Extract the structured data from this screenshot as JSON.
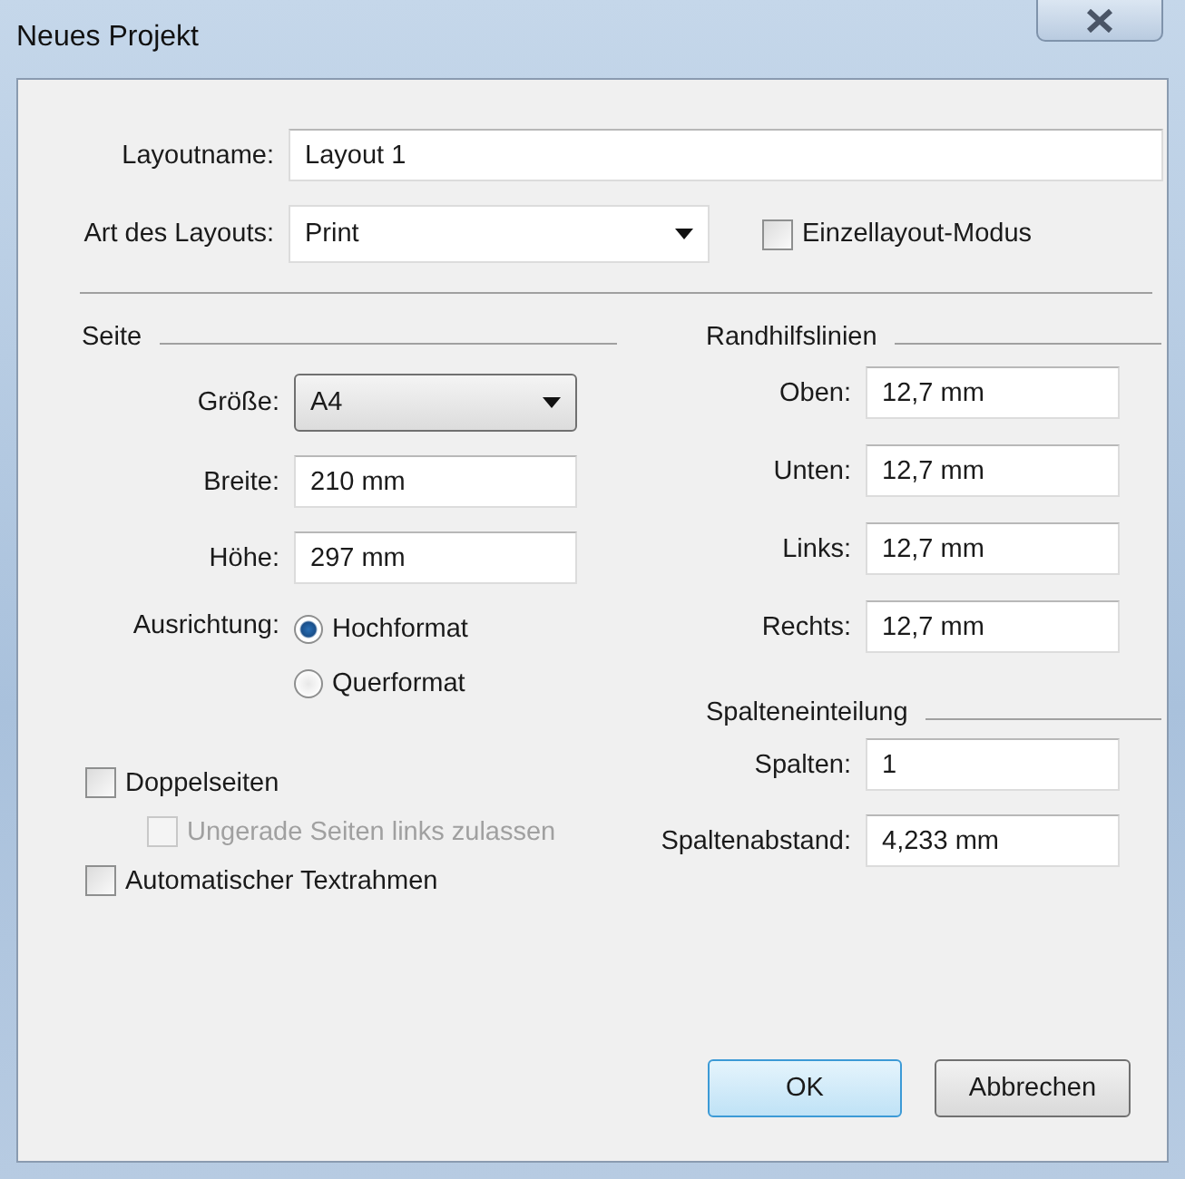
{
  "window": {
    "title": "Neues Projekt"
  },
  "layout_name": {
    "label": "Layoutname:",
    "value": "Layout 1"
  },
  "layout_type": {
    "label": "Art des Layouts:",
    "value": "Print"
  },
  "single_layout_mode": {
    "label": "Einzellayout-Modus",
    "checked": false
  },
  "page": {
    "heading": "Seite",
    "size": {
      "label": "Größe:",
      "value": "A4"
    },
    "fields": [
      {
        "label": "Breite:",
        "value": "210 mm"
      },
      {
        "label": "Höhe:",
        "value": "297 mm"
      }
    ],
    "orientation": {
      "label": "Ausrichtung:",
      "options": [
        {
          "label": "Hochformat",
          "selected": true
        },
        {
          "label": "Querformat",
          "selected": false
        }
      ]
    }
  },
  "options": [
    {
      "label": "Doppelseiten",
      "checked": false,
      "disabled": false,
      "children": [
        {
          "label": "Ungerade Seiten links zulassen",
          "checked": false,
          "disabled": true
        }
      ]
    },
    {
      "label": "Automatischer Textrahmen",
      "checked": false,
      "disabled": false
    }
  ],
  "margins": {
    "heading": "Randhilfslinien",
    "fields": [
      {
        "label": "Oben:",
        "value": "12,7 mm"
      },
      {
        "label": "Unten:",
        "value": "12,7 mm"
      },
      {
        "label": "Links:",
        "value": "12,7 mm"
      },
      {
        "label": "Rechts:",
        "value": "12,7 mm"
      }
    ]
  },
  "columns": {
    "heading": "Spalteneinteilung",
    "fields": [
      {
        "label": "Spalten:",
        "value": "1"
      },
      {
        "label": "Spaltenabstand:",
        "value": "4,233 mm"
      }
    ]
  },
  "buttons": [
    {
      "label": "OK",
      "default": true
    },
    {
      "label": "Abbrechen",
      "default": false
    }
  ]
}
